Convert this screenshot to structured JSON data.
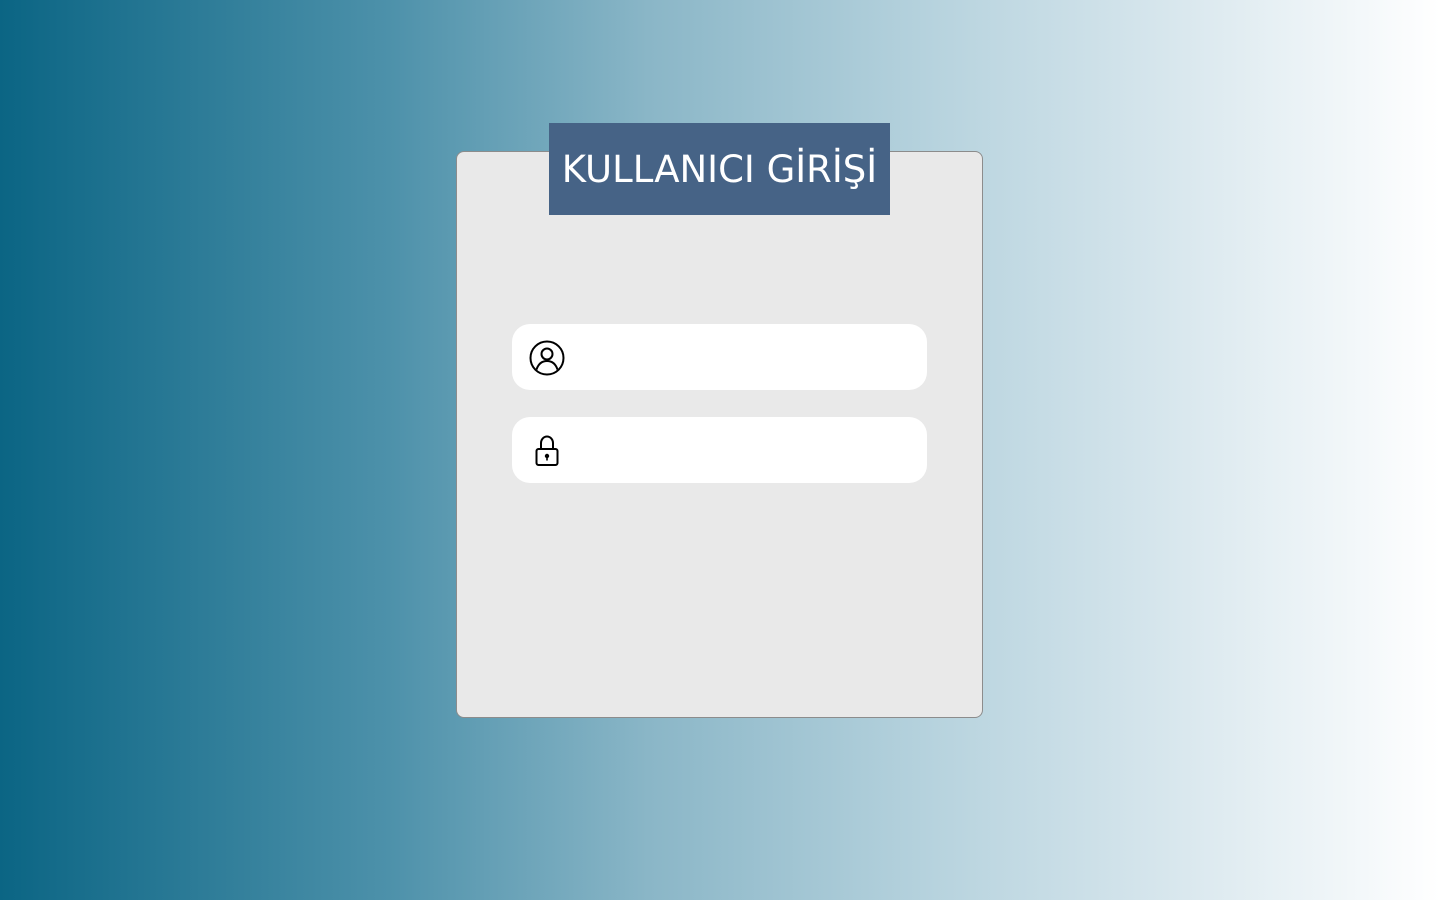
{
  "login": {
    "title": "KULLANICI GİRİŞİ",
    "username_field": {
      "icon": "user-circle-icon",
      "value": "",
      "placeholder": ""
    },
    "password_field": {
      "icon": "lock-icon",
      "value": "",
      "placeholder": ""
    }
  },
  "colors": {
    "gradient_start": "#0b6584",
    "gradient_end": "#ffffff",
    "card_background": "#e9e9e9",
    "title_background": "#466386",
    "field_background": "#ffffff"
  }
}
